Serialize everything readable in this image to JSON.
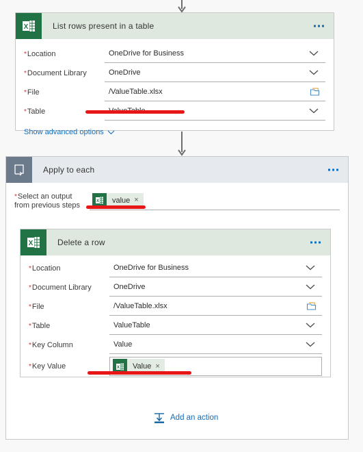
{
  "flow": {
    "connector_top_icon": "arrow-down-icon",
    "connector_mid_icon": "arrow-down-icon"
  },
  "list_rows_card": {
    "icon": "excel-icon",
    "title": "List rows present in a table",
    "menu_icon": "ellipsis-icon",
    "fields": [
      {
        "label": "Location",
        "required": "*",
        "value": "OneDrive for Business",
        "control": "dropdown",
        "control_icon": "chevron-down-icon"
      },
      {
        "label": "Document Library",
        "required": "*",
        "value": "OneDrive",
        "control": "dropdown",
        "control_icon": "chevron-down-icon"
      },
      {
        "label": "File",
        "required": "*",
        "value": "/ValueTable.xlsx",
        "control": "picker",
        "control_icon": "folder-icon"
      },
      {
        "label": "Table",
        "required": "*",
        "value": "ValueTable",
        "control": "dropdown",
        "control_icon": "chevron-down-icon"
      }
    ],
    "advanced_link": "Show advanced options",
    "advanced_icon": "chevron-down-icon"
  },
  "apply_to_each_card": {
    "icon": "loop-icon",
    "title": "Apply to each",
    "menu_icon": "ellipsis-icon",
    "select_output": {
      "label_line1": "Select an output",
      "label_line2": "from previous steps",
      "required": "*",
      "token": {
        "icon": "excel-icon",
        "label": "value",
        "remove_icon": "close-icon",
        "remove_glyph": "×"
      }
    },
    "add_action": {
      "icon": "insert-action-icon",
      "label": "Add an action"
    }
  },
  "delete_row_card": {
    "icon": "excel-icon",
    "title": "Delete a row",
    "menu_icon": "ellipsis-icon",
    "fields": [
      {
        "label": "Location",
        "required": "*",
        "value": "OneDrive for Business",
        "control": "dropdown",
        "control_icon": "chevron-down-icon"
      },
      {
        "label": "Document Library",
        "required": "*",
        "value": "OneDrive",
        "control": "dropdown",
        "control_icon": "chevron-down-icon"
      },
      {
        "label": "File",
        "required": "*",
        "value": "/ValueTable.xlsx",
        "control": "picker",
        "control_icon": "folder-icon"
      },
      {
        "label": "Table",
        "required": "*",
        "value": "ValueTable",
        "control": "dropdown",
        "control_icon": "chevron-down-icon"
      },
      {
        "label": "Key Column",
        "required": "*",
        "value": "Value",
        "control": "dropdown",
        "control_icon": "chevron-down-icon"
      }
    ],
    "key_value": {
      "label": "Key Value",
      "required": "*",
      "token": {
        "icon": "excel-icon",
        "label": "Value",
        "remove_icon": "close-icon",
        "remove_glyph": "×"
      }
    }
  },
  "annotations": {
    "marker_color": "#e81717",
    "markers": [
      {
        "name": "table-field-highlight"
      },
      {
        "name": "select-output-highlight"
      },
      {
        "name": "key-value-highlight"
      }
    ]
  },
  "colors": {
    "excel_green": "#217346",
    "excel_header_bg": "#dfe8df",
    "loop_icon_bg": "#6b7b8c",
    "loop_header_bg": "#e6eaee",
    "link_blue": "#0f6cbd",
    "required_red": "#d13438",
    "marker_red": "#e81717"
  }
}
